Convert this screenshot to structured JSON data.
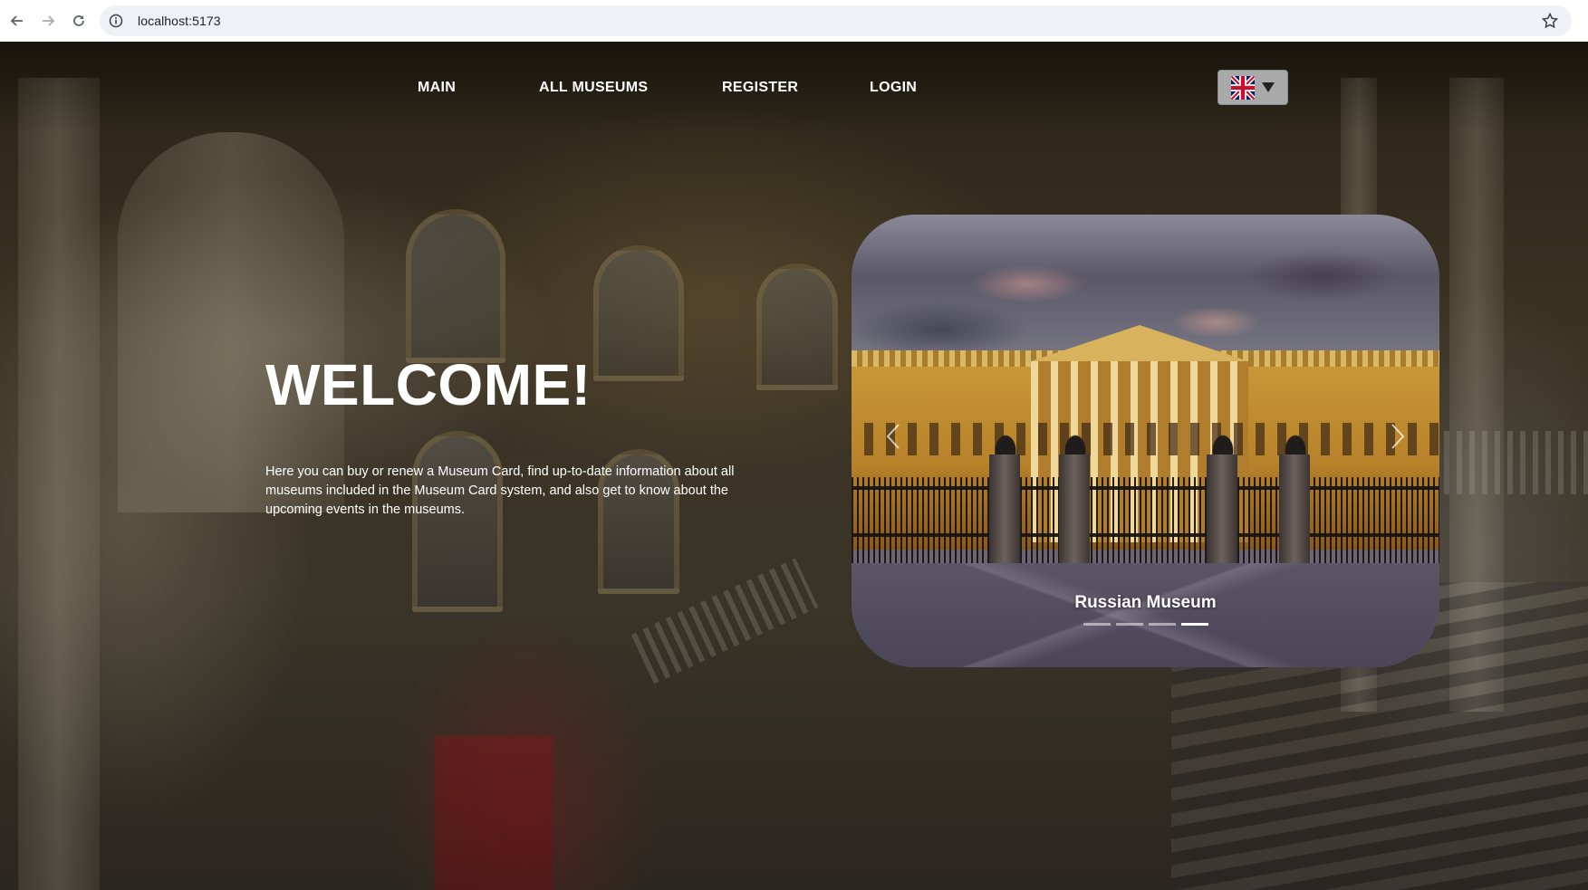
{
  "browser": {
    "url": "localhost:5173"
  },
  "nav": {
    "items": [
      {
        "label": "MAIN"
      },
      {
        "label": "ALL MUSEUMS"
      },
      {
        "label": "REGISTER"
      },
      {
        "label": "LOGIN"
      }
    ],
    "language_flag": "uk-flag-icon"
  },
  "hero": {
    "title": "WELCOME!",
    "description": "Here you can buy or renew a Museum Card, find up-to-date information about all museums included in the Museum Card system, and also get to know about the upcoming events in the museums."
  },
  "carousel": {
    "caption": "Russian Museum",
    "indicator_count": 4,
    "active_index": 3
  },
  "colors": {
    "text": "#ffffff",
    "lang_button": "#a9a9a9"
  }
}
